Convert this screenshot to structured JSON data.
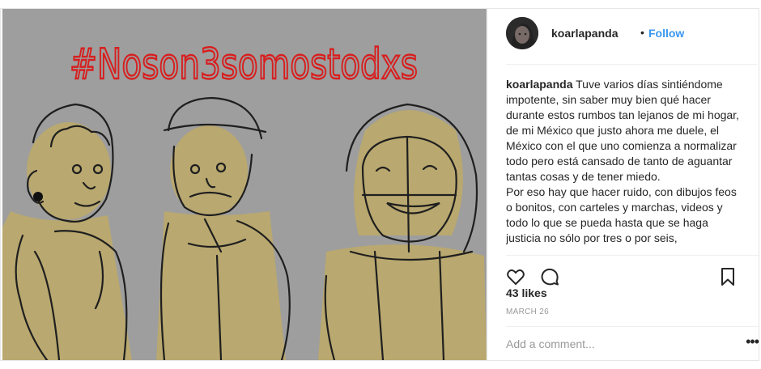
{
  "post": {
    "image_text": "#Noson3somostodxs",
    "username": "koarlapanda",
    "separator": "•",
    "follow_label": "Follow",
    "caption_author": "koarlapanda",
    "caption_lines": [
      " Tuve varios días sintiéndome impotente, sin saber muy bien qué hacer durante estos rumbos tan lejanos de mi hogar, de mi México que justo ahora me duele, el México con el que uno comienza a normalizar todo pero está cansado de tanto de aguantar tantas cosas y de tener miedo.",
      "Por eso hay que hacer ruido, con dibujos feos o bonitos, con carteles y marchas, videos y todo lo que se pueda hasta que se haga justicia no sólo por tres o por seis,"
    ],
    "likes": "43 likes",
    "date": "MARCH 26",
    "comment_placeholder": "Add a comment...",
    "more_icon": "•••"
  },
  "icons": [
    "heart-icon",
    "comment-icon",
    "bookmark-icon",
    "more-options-icon"
  ],
  "colors": {
    "accent": "#3897f0",
    "hashtag_red": "#d81e1e",
    "canvas_gray": "#9e9e9e",
    "skin_khaki": "#b9a86f"
  }
}
